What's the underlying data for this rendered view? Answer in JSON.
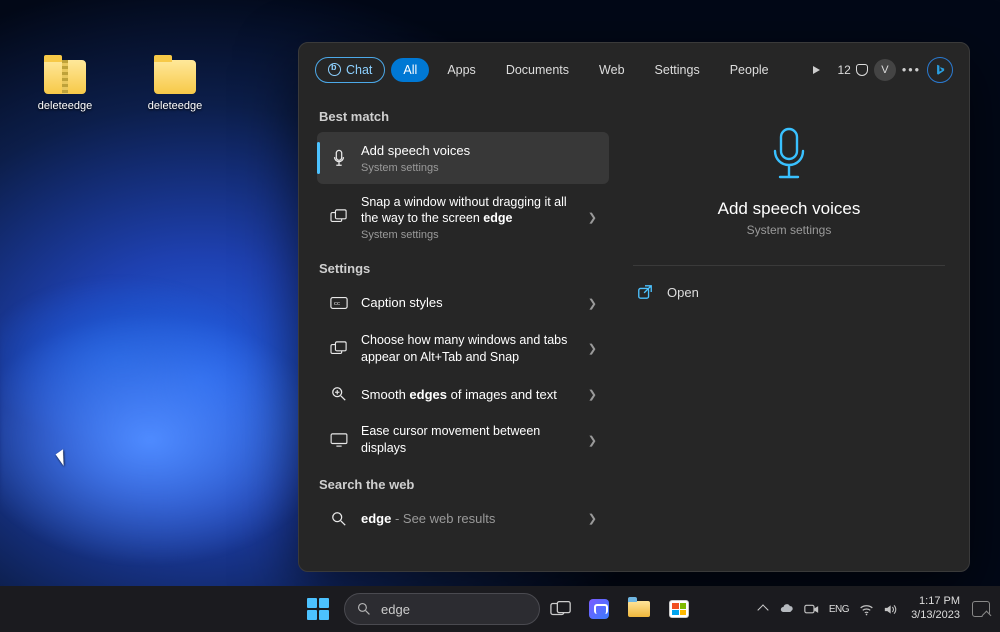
{
  "desktop": {
    "icons": [
      {
        "label": "deleteedge",
        "type": "zip"
      },
      {
        "label": "deleteedge",
        "type": "folder"
      }
    ]
  },
  "search_panel": {
    "tabs": {
      "chat": "Chat",
      "all": "All",
      "apps": "Apps",
      "documents": "Documents",
      "web": "Web",
      "settings": "Settings",
      "people": "People"
    },
    "rewards_points": "12",
    "profile_initial": "V",
    "sections": {
      "best_match": "Best match",
      "settings": "Settings",
      "search_web": "Search the web"
    },
    "results": {
      "best_match_1": {
        "title": "Add speech voices",
        "sub": "System settings"
      },
      "best_match_2": {
        "title_pre": "Snap a window without dragging it all the way to the screen ",
        "title_bold": "edge",
        "sub": "System settings"
      },
      "settings_1": {
        "title": "Caption styles"
      },
      "settings_2": {
        "title": "Choose how many windows and tabs appear on Alt+Tab and Snap"
      },
      "settings_3": {
        "title_pre": "Smooth ",
        "title_bold": "edges",
        "title_post": " of images and text"
      },
      "settings_4": {
        "title": "Ease cursor movement between displays"
      },
      "web_1": {
        "title_bold": "edge",
        "title_post": " - See web results"
      }
    },
    "preview": {
      "title": "Add speech voices",
      "sub": "System settings",
      "actions": {
        "open": "Open"
      }
    }
  },
  "taskbar": {
    "search_value": "edge",
    "time": "1:17 PM",
    "date": "3/13/2023"
  }
}
